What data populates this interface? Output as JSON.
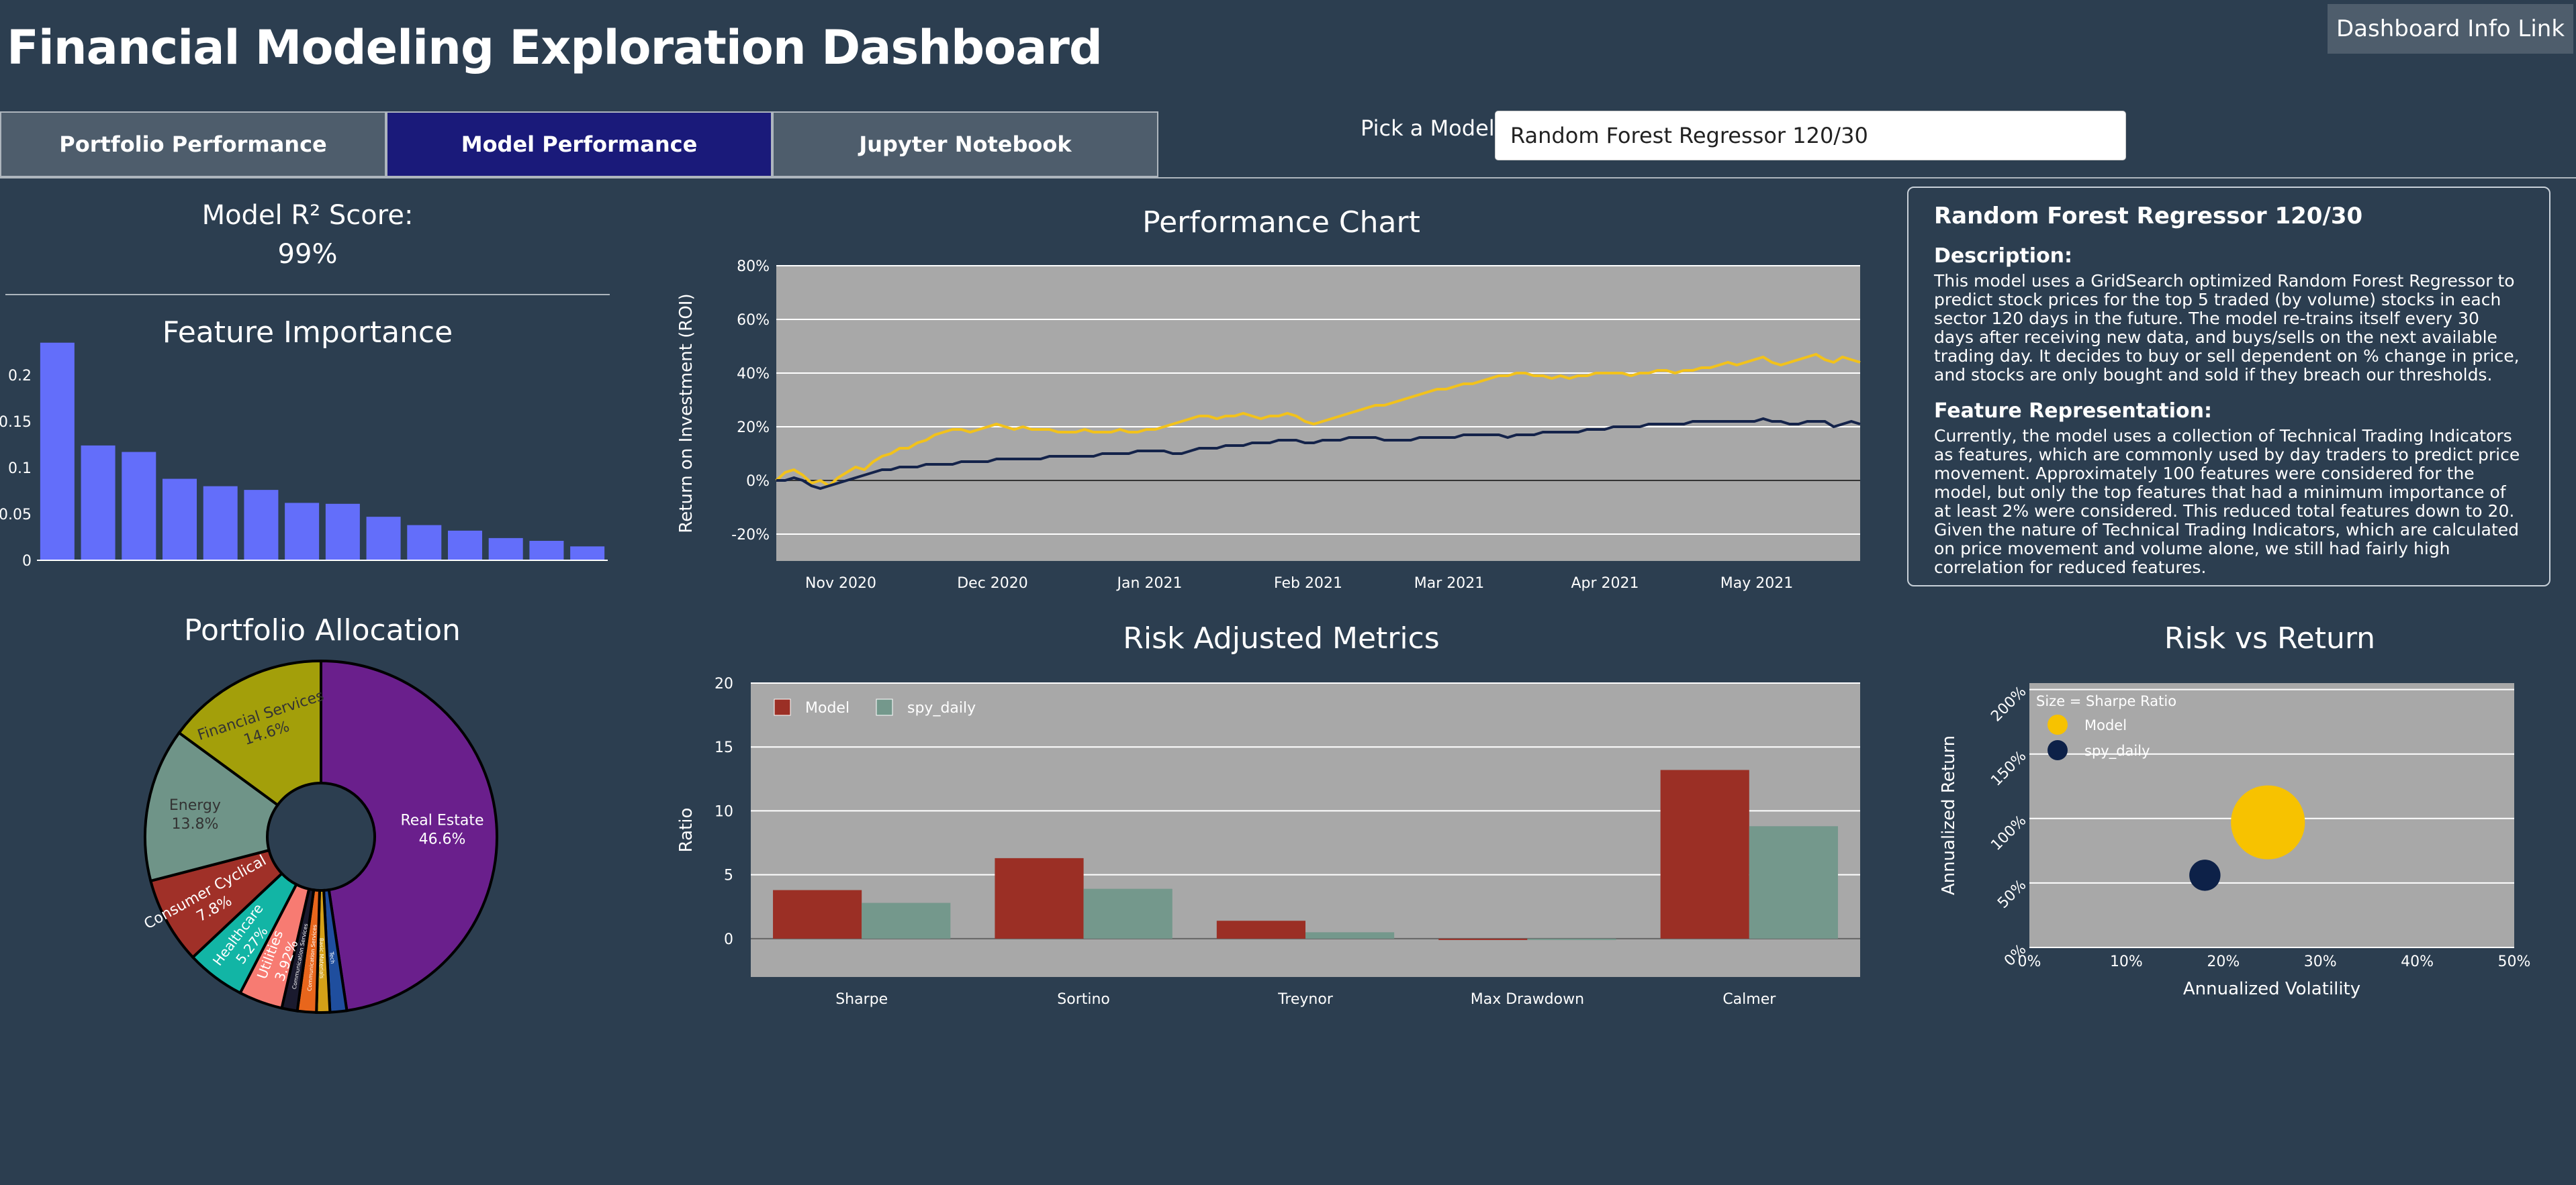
{
  "header": {
    "title": "Financial Modeling Exploration Dashboard",
    "info_link": "Dashboard Info Link"
  },
  "tabs": [
    {
      "label": "Portfolio Performance",
      "active": false
    },
    {
      "label": "Model Performance",
      "active": true
    },
    {
      "label": "Jupyter Notebook",
      "active": false
    }
  ],
  "model_picker": {
    "label": "Pick a Model:",
    "selected": "Random Forest Regressor 120/30"
  },
  "r2": {
    "title": "Model R² Score:",
    "value": "99%"
  },
  "description": {
    "model_name": "Random Forest Regressor 120/30",
    "description_heading": "Description:",
    "description_text": "This model uses a GridSearch optimized Random Forest Regressor to predict stock prices for the top 5 traded (by volume) stocks in each sector 120 days in the future. The model re-trains itself every 30 days after receiving new data, and buys/sells on the next available trading day. It decides to buy or sell dependent on % change in price, and stocks are only bought and sold if they breach our thresholds.",
    "feature_heading": "Feature Representation:",
    "feature_text": "Currently, the model uses a collection of Technical Trading Indicators as features, which are commonly used by day traders to predict price movement. Approximately 100 features were considered for the model, but only the top features that had a minimum importance of at least 2% were considered. This reduced total features down to 20. Given the nature of Technical Trading Indicators, which are calculated on price movement and volume alone, we still had fairly high correlation for reduced features."
  },
  "chart_data": [
    {
      "id": "feature_importance",
      "type": "bar",
      "title": "Feature Importance",
      "color": "#636efa",
      "values": [
        0.235,
        0.124,
        0.117,
        0.088,
        0.08,
        0.076,
        0.062,
        0.061,
        0.047,
        0.038,
        0.032,
        0.024,
        0.021,
        0.015
      ],
      "yticks": [
        "0",
        "0.05",
        "0.1",
        "0.15",
        "0.2"
      ],
      "ylim": [
        0,
        0.25
      ]
    },
    {
      "id": "portfolio_allocation",
      "type": "pie",
      "title": "Portfolio Allocation",
      "slices": [
        {
          "label": "Real Estate",
          "value": 46.6,
          "text": "46.6%",
          "color": "#6a1f8c"
        },
        {
          "label": "Tech",
          "value": 1.5,
          "text": "",
          "color": "#1f4e9e"
        },
        {
          "label": "Basic Materials",
          "value": 1.2,
          "text": "",
          "color": "#d4a017"
        },
        {
          "label": "Communication Services",
          "value": 1.7,
          "text": "",
          "color": "#e8661c"
        },
        {
          "label": "Communication Services",
          "value": 1.4,
          "text": "",
          "color": "#1a1a2e"
        },
        {
          "label": "Utilities",
          "value": 3.92,
          "text": "3.92%",
          "color": "#f77b72"
        },
        {
          "label": "Healthcare",
          "value": 5.27,
          "text": "5.27%",
          "color": "#12b5a5"
        },
        {
          "label": "Consumer Cyclical",
          "value": 7.8,
          "text": "7.8%",
          "color": "#a03028"
        },
        {
          "label": "Energy",
          "value": 13.8,
          "text": "13.8%",
          "color": "#6f9488"
        },
        {
          "label": "Financial Services",
          "value": 14.6,
          "text": "14.6%",
          "color": "#a39f0a"
        }
      ]
    },
    {
      "id": "performance",
      "type": "line",
      "title": "Performance Chart",
      "ylabel": "Return on Investment (ROI)",
      "xticks": [
        "Nov 2020",
        "Dec 2020",
        "Jan 2021",
        "Feb 2021",
        "Mar 2021",
        "Apr 2021",
        "May 2021"
      ],
      "yticks": [
        "80%",
        "60%",
        "40%",
        "20%",
        "0%",
        "-20%"
      ],
      "ylim": [
        -30,
        80
      ],
      "series": [
        {
          "color": "#f2c21b",
          "values": [
            0,
            3,
            4,
            2,
            -1,
            0,
            -2,
            1,
            3,
            5,
            4,
            7,
            9,
            10,
            12,
            12,
            14,
            15,
            17,
            18,
            19,
            19,
            18,
            19,
            20,
            21,
            20,
            19,
            20,
            19,
            19,
            19,
            18,
            18,
            18,
            19,
            18,
            18,
            18,
            19,
            18,
            18,
            19,
            19,
            20,
            21,
            22,
            23,
            24,
            24,
            23,
            24,
            24,
            25,
            24,
            23,
            24,
            24,
            25,
            24,
            22,
            21,
            22,
            23,
            24,
            25,
            26,
            27,
            28,
            28,
            29,
            30,
            31,
            32,
            33,
            34,
            34,
            35,
            36,
            36,
            37,
            38,
            39,
            39,
            40,
            40,
            39,
            39,
            38,
            39,
            38,
            39,
            39,
            40,
            40,
            40,
            40,
            39,
            40,
            40,
            41,
            41,
            40,
            41,
            41,
            42,
            42,
            43,
            44,
            43,
            44,
            45,
            46,
            44,
            43,
            44,
            45,
            46,
            47,
            45,
            44,
            46,
            45,
            44
          ]
        },
        {
          "color": "#14234a",
          "values": [
            0,
            0,
            1,
            0,
            -2,
            -3,
            -2,
            -1,
            0,
            1,
            2,
            3,
            4,
            4,
            5,
            5,
            5,
            6,
            6,
            6,
            6,
            7,
            7,
            7,
            7,
            8,
            8,
            8,
            8,
            8,
            8,
            9,
            9,
            9,
            9,
            9,
            9,
            10,
            10,
            10,
            10,
            11,
            11,
            11,
            11,
            10,
            10,
            11,
            12,
            12,
            12,
            13,
            13,
            13,
            14,
            14,
            14,
            15,
            15,
            15,
            14,
            14,
            15,
            15,
            15,
            16,
            16,
            16,
            16,
            15,
            15,
            15,
            15,
            16,
            16,
            16,
            16,
            16,
            17,
            17,
            17,
            17,
            17,
            16,
            17,
            17,
            17,
            18,
            18,
            18,
            18,
            18,
            19,
            19,
            19,
            20,
            20,
            20,
            20,
            21,
            21,
            21,
            21,
            21,
            22,
            22,
            22,
            22,
            22,
            22,
            22,
            22,
            23,
            22,
            22,
            21,
            21,
            22,
            22,
            22,
            20,
            21,
            22,
            21
          ]
        }
      ]
    },
    {
      "id": "risk_adjusted_metrics",
      "type": "bar",
      "title": "Risk Adjusted Metrics",
      "ylabel": "Ratio",
      "categories": [
        "Sharpe",
        "Sortino",
        "Treynor",
        "Max Drawdown",
        "Calmer"
      ],
      "yticks": [
        "20",
        "15",
        "10",
        "5",
        "0"
      ],
      "ylim": [
        -3,
        20
      ],
      "series": [
        {
          "name": "Model",
          "color": "#9b2f25",
          "values": [
            3.8,
            6.3,
            1.4,
            -0.1,
            13.2
          ]
        },
        {
          "name": "spy_daily",
          "color": "#74988c",
          "values": [
            2.8,
            3.9,
            0.5,
            -0.1,
            8.8
          ]
        }
      ]
    },
    {
      "id": "risk_vs_return",
      "type": "scatter",
      "title": "Risk vs Return",
      "xlabel": "Annualized Volatility",
      "ylabel": "Annualized Return",
      "legend_title": "Size = Sharpe Ratio",
      "xticks": [
        "0%",
        "10%",
        "20%",
        "30%",
        "40%",
        "50%"
      ],
      "yticks": [
        "200%",
        "150%",
        "100%",
        "50%",
        "0%"
      ],
      "xlim": [
        0,
        50
      ],
      "ylim": [
        0,
        205
      ],
      "series": [
        {
          "name": "Model",
          "color": "#f7c200",
          "x": 24.6,
          "y": 97,
          "size": 3.8
        },
        {
          "name": "spy_daily",
          "color": "#0d2148",
          "x": 18.1,
          "y": 56,
          "size": 1.6
        }
      ]
    }
  ]
}
